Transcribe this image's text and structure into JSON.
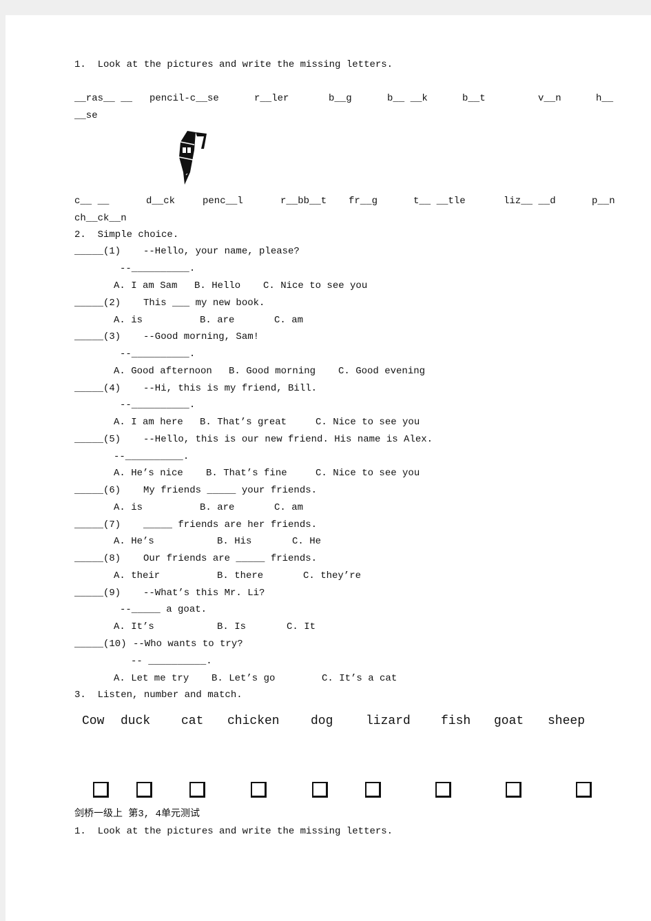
{
  "section1": {
    "heading": "1.  Look at the pictures and write the missing letters.",
    "row1": [
      "__ras__ __",
      "pencil-c__se",
      "r__ler",
      "b__g",
      "b__ __k",
      "b__t",
      "v__n",
      "h__"
    ],
    "row1_wrap": "__se",
    "row2": [
      "c__ __",
      "d__ck",
      "penc__l",
      "r__bb__t",
      "fr__g",
      "t__ __tle",
      "liz__ __d",
      "p__n"
    ],
    "row2_wrap": "ch__ck__n",
    "image_icon": "fountain-pen-icon"
  },
  "section2": {
    "heading": "2.  Simple choice.",
    "q1": {
      "num": "_____(1)",
      "text": "--Hello, your name, please?",
      "answer": "--__________.",
      "a": "A. I am Sam",
      "b": "B. Hello",
      "c": "C. Nice to see you"
    },
    "q2": {
      "num": "_____(2)",
      "text": "This ___ my new book.",
      "a": "A. is",
      "b": "B. are",
      "c": "C. am"
    },
    "q3": {
      "num": "_____(3)",
      "text": "--Good morning, Sam!",
      "answer": "--__________.",
      "a": "A. Good afternoon",
      "b": "B. Good morning",
      "c": "C. Good evening"
    },
    "q4": {
      "num": "_____(4)",
      "text": "--Hi, this is my friend, Bill.",
      "answer": "--__________.",
      "a": "A. I am here",
      "b": "B. That’s great",
      "c": "C. Nice to see you"
    },
    "q5": {
      "num": "_____(5)",
      "text": "--Hello, this is our new friend. His name is Alex.",
      "answer": "--__________.",
      "a": "A. He’s nice",
      "b": "B. That’s fine",
      "c": "C. Nice to see you"
    },
    "q6": {
      "num": "_____(6)",
      "text": "My friends _____ your friends.",
      "a": "A. is",
      "b": "B. are",
      "c": "C. am"
    },
    "q7": {
      "num": "_____(7)",
      "text": "_____ friends are her friends.",
      "a": "A. He’s",
      "b": "B. His",
      "c": "C. He"
    },
    "q8": {
      "num": "_____(8)",
      "text": "Our friends are _____ friends.",
      "a": "A. their",
      "b": "B. there",
      "c": "C. they’re"
    },
    "q9": {
      "num": "_____(9)",
      "text": "--What’s this Mr. Li?",
      "answer": "--_____ a goat.",
      "a": "A. It’s",
      "b": "B. Is",
      "c": "C. It"
    },
    "q10": {
      "num": "_____(10)",
      "text": "--Who wants to try?",
      "answer": "-- __________.",
      "a": "A. Let me try",
      "b": "B. Let’s go",
      "c": "C. It’s a cat"
    }
  },
  "section3": {
    "heading": "3.  Listen, number and match.",
    "animals": [
      "Cow",
      "duck",
      "cat",
      "chicken",
      "dog",
      "lizard",
      "fish",
      "goat",
      "sheep"
    ]
  },
  "footer": {
    "title": "剑桥一级上 第3, 4单元测试",
    "heading": "1.  Look at the pictures and write the missing letters."
  }
}
